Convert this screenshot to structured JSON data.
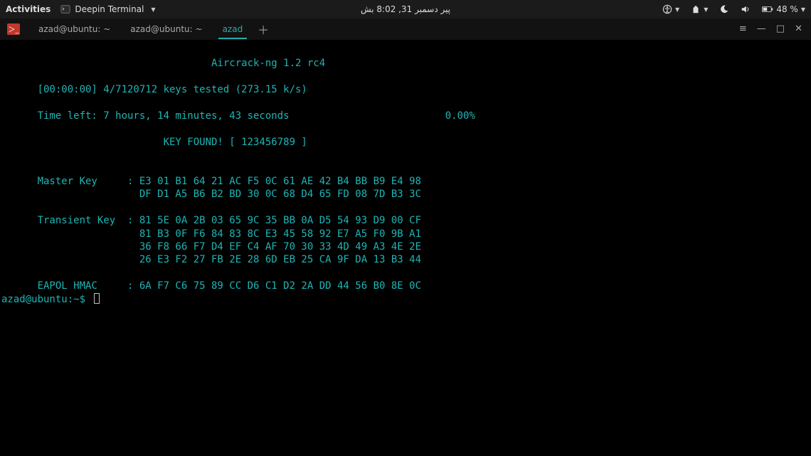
{
  "gnome": {
    "activities": "Activities",
    "app_name": "Deepin Terminal",
    "clock": "پیر دسمبر 31, 8:02 بش",
    "battery": "48 %"
  },
  "tabs": [
    {
      "label": "azad@ubuntu: ~",
      "active": false
    },
    {
      "label": "azad@ubuntu: ~",
      "active": false
    },
    {
      "label": "azad",
      "active": true
    }
  ],
  "terminal": {
    "title": "Aircrack-ng 1.2 rc4",
    "status_line": "[00:00:00] 4/7120712 keys tested (273.15 k/s)",
    "time_left_line": "Time left: 7 hours, 14 minutes, 43 seconds                          0.00%",
    "key_found_line": "KEY FOUND! [ 123456789 ]",
    "master_key_label": "Master Key",
    "master_key_rows": [
      "E3 01 B1 64 21 AC F5 0C 61 AE 42 B4 BB B9 E4 98",
      "DF D1 A5 B6 B2 BD 30 0C 68 D4 65 FD 08 7D B3 3C"
    ],
    "transient_key_label": "Transient Key",
    "transient_key_rows": [
      "81 5E 0A 2B 03 65 9C 35 BB 0A D5 54 93 D9 00 CF",
      "81 B3 0F F6 84 83 8C E3 45 58 92 E7 A5 F0 9B A1",
      "36 F8 66 F7 D4 EF C4 AF 70 30 33 4D 49 A3 4E 2E",
      "26 E3 F2 27 FB 2E 28 6D EB 25 CA 9F DA 13 B3 44"
    ],
    "eapol_label": "EAPOL HMAC",
    "eapol_row": "6A F7 C6 75 89 CC D6 C1 D2 2A DD 44 56 B0 8E 0C",
    "prompt": "azad@ubuntu:~$"
  }
}
